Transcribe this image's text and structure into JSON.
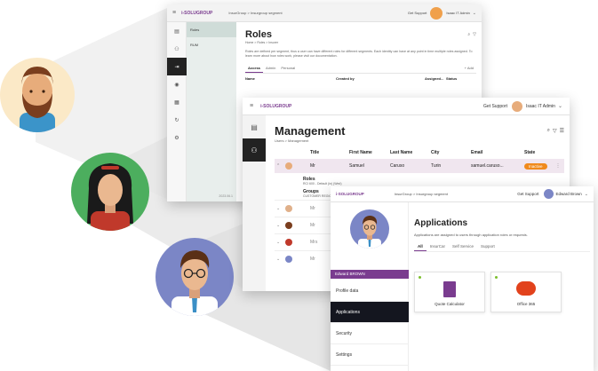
{
  "colors": {
    "accent": "#f08a1c",
    "brand": "#7a3c8f",
    "dark": "#14161f"
  },
  "roles_window": {
    "logo": "i-SOLUGROUP",
    "breadcrumb_company": "InsurGroup",
    "breadcrumb_sep": ">",
    "breadcrumb_segment": "Insurgroup segment",
    "support_link": "Get Support",
    "user_name": "Isaac IT Admin",
    "side_items": [
      "Roles",
      "RUM"
    ],
    "side_footer": "2023.06.1",
    "title": "Roles",
    "subtitle": "Home > Roles > Insurer",
    "description": "Roles are defined per segment, thus a user can have different roles for different segments. Each identity can have at any point in time multiple roles assigned. To learn more about how roles work, please visit our documentation.",
    "tabs": [
      "Access",
      "Admin",
      "Personal"
    ],
    "add_label": "+ Add",
    "columns": [
      "Name",
      "Created by",
      "Assigned...",
      "Status"
    ]
  },
  "management_window": {
    "logo": "i-SOLUGROUP",
    "support_link": "Get Support",
    "user_name": "Isaac IT Admin",
    "title": "Management",
    "subtitle": "Users > Management",
    "columns": [
      "Title",
      "First Name",
      "Last Name",
      "City",
      "Email",
      "State"
    ],
    "row": {
      "title": "Mr",
      "first": "Samuel",
      "last": "Caruso",
      "city": "Turin",
      "email": "samuel.caruso...",
      "state": "Inactive"
    },
    "roles_label": "Roles",
    "roles_value": "RCI 600 - Default (in) (Wed)",
    "groups_label": "Groups",
    "groups_value": "CUSTOMER REGIONS - ...",
    "other_titles": [
      "Mr",
      "Mr",
      "Mrs",
      "Mr"
    ]
  },
  "applications_window": {
    "logo": "i-SOLUGROUP",
    "breadcrumb_company": "InsurGroup",
    "breadcrumb_sep": ">",
    "breadcrumb_segment": "Insurgroup segment",
    "support_link": "Get Support",
    "user_name": "Edward Brown",
    "profile_name": "Edward BROWN",
    "nav_items": [
      "Profile data",
      "Applications",
      "Security",
      "Settings"
    ],
    "title": "Applications",
    "description": "Applications are assigned to users through application roles or requests.",
    "tabs": [
      "All",
      "InsurCar",
      "Self Service",
      "Support"
    ],
    "apps": [
      {
        "name": "Quote Calculator",
        "icon": "calculator-doc-icon"
      },
      {
        "name": "Office 365",
        "icon": "office-cloud-icon"
      }
    ]
  }
}
